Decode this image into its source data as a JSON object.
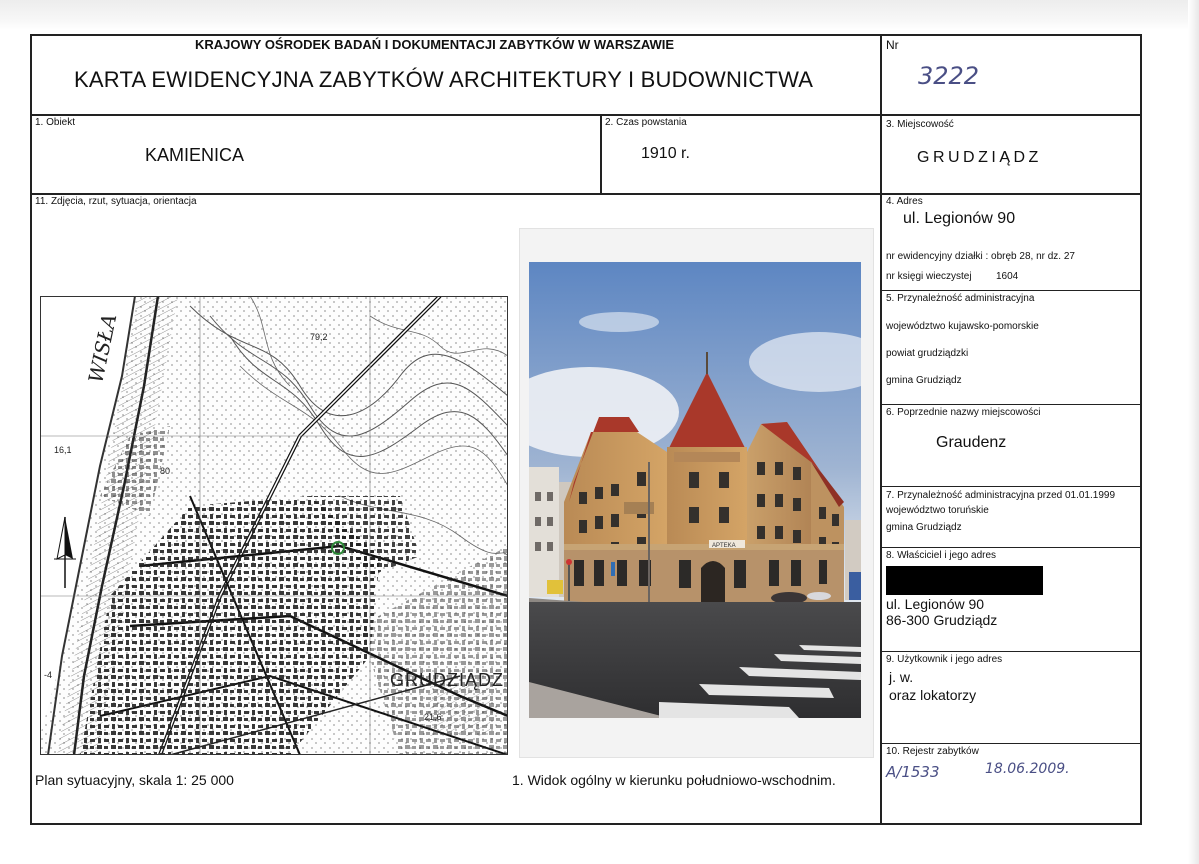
{
  "header": {
    "institution": "KRAJOWY OŚRODEK BADAŃ I DOKUMENTACJI ZABYTKÓW W WARSZAWIE",
    "title": "KARTA EWIDENCYJNA ZABYTKÓW ARCHITEKTURY I BUDOWNICTWA",
    "nr_label": "Nr",
    "nr_value": "3222"
  },
  "fields": {
    "obiekt": {
      "label": "1. Obiekt",
      "value": "KAMIENICA"
    },
    "czas": {
      "label": "2. Czas powstania",
      "value": "1910 r."
    },
    "miejscowosc": {
      "label": "3. Miejscowość",
      "value": "GRUDZIĄDZ"
    },
    "adres": {
      "label": "4. Adres",
      "street": "ul. Legionów 90",
      "dzialka": "nr ewidencyjny działki : obręb 28, nr dz. 27",
      "ksiega_label": "nr księgi wieczystej",
      "ksiega_value": "1604"
    },
    "przynaleznosc": {
      "label": "5. Przynależność administracyjna",
      "wojewodztwo": "województwo kujawsko-pomorskie",
      "powiat": "powiat grudziądzki",
      "gmina": "gmina Grudziądz"
    },
    "poprzednie": {
      "label": "6. Poprzednie nazwy miejscowości",
      "value": "Graudenz"
    },
    "przed1999": {
      "label": "7. Przynależność administracyjna przed 01.01.1999",
      "wojewodztwo": "województwo toruńskie",
      "gmina": "gmina Grudziądz"
    },
    "wlasciciel": {
      "label": "8. Właściciel i jego adres",
      "street": "ul. Legionów 90",
      "city": "86-300 Grudziądz"
    },
    "uzytkownik": {
      "label": "9. Użytkownik i jego adres",
      "line1": "j. w.",
      "line2": "oraz lokatorzy"
    },
    "rejestr": {
      "label": "10. Rejestr zabytków",
      "number": "A/1533",
      "date": "18.06.2009."
    }
  },
  "photos": {
    "label": "11. Zdjęcia, rzut, sytuacja, orientacja",
    "map_caption": "Plan sytuacyjny, skala 1:  25 000",
    "photo_caption": "1. Widok ogólny w kierunku południowo-wschodnim.",
    "map_labels": {
      "river": "WISŁA",
      "city": "GRUDZIĄDZ",
      "elev1": "16,1",
      "elev2": "80",
      "elev3": "21,6",
      "elev4": "79,2",
      "elev5": "-4"
    },
    "shop_sign": "APTEKA"
  },
  "colors": {
    "border": "#222222",
    "handwriting": "#4a4f85",
    "sky_top": "#5d86c2",
    "sky_bottom": "#dfe6ef",
    "facade": "#c8985f",
    "roof": "#a9382a",
    "road": "#3a3a3c"
  }
}
